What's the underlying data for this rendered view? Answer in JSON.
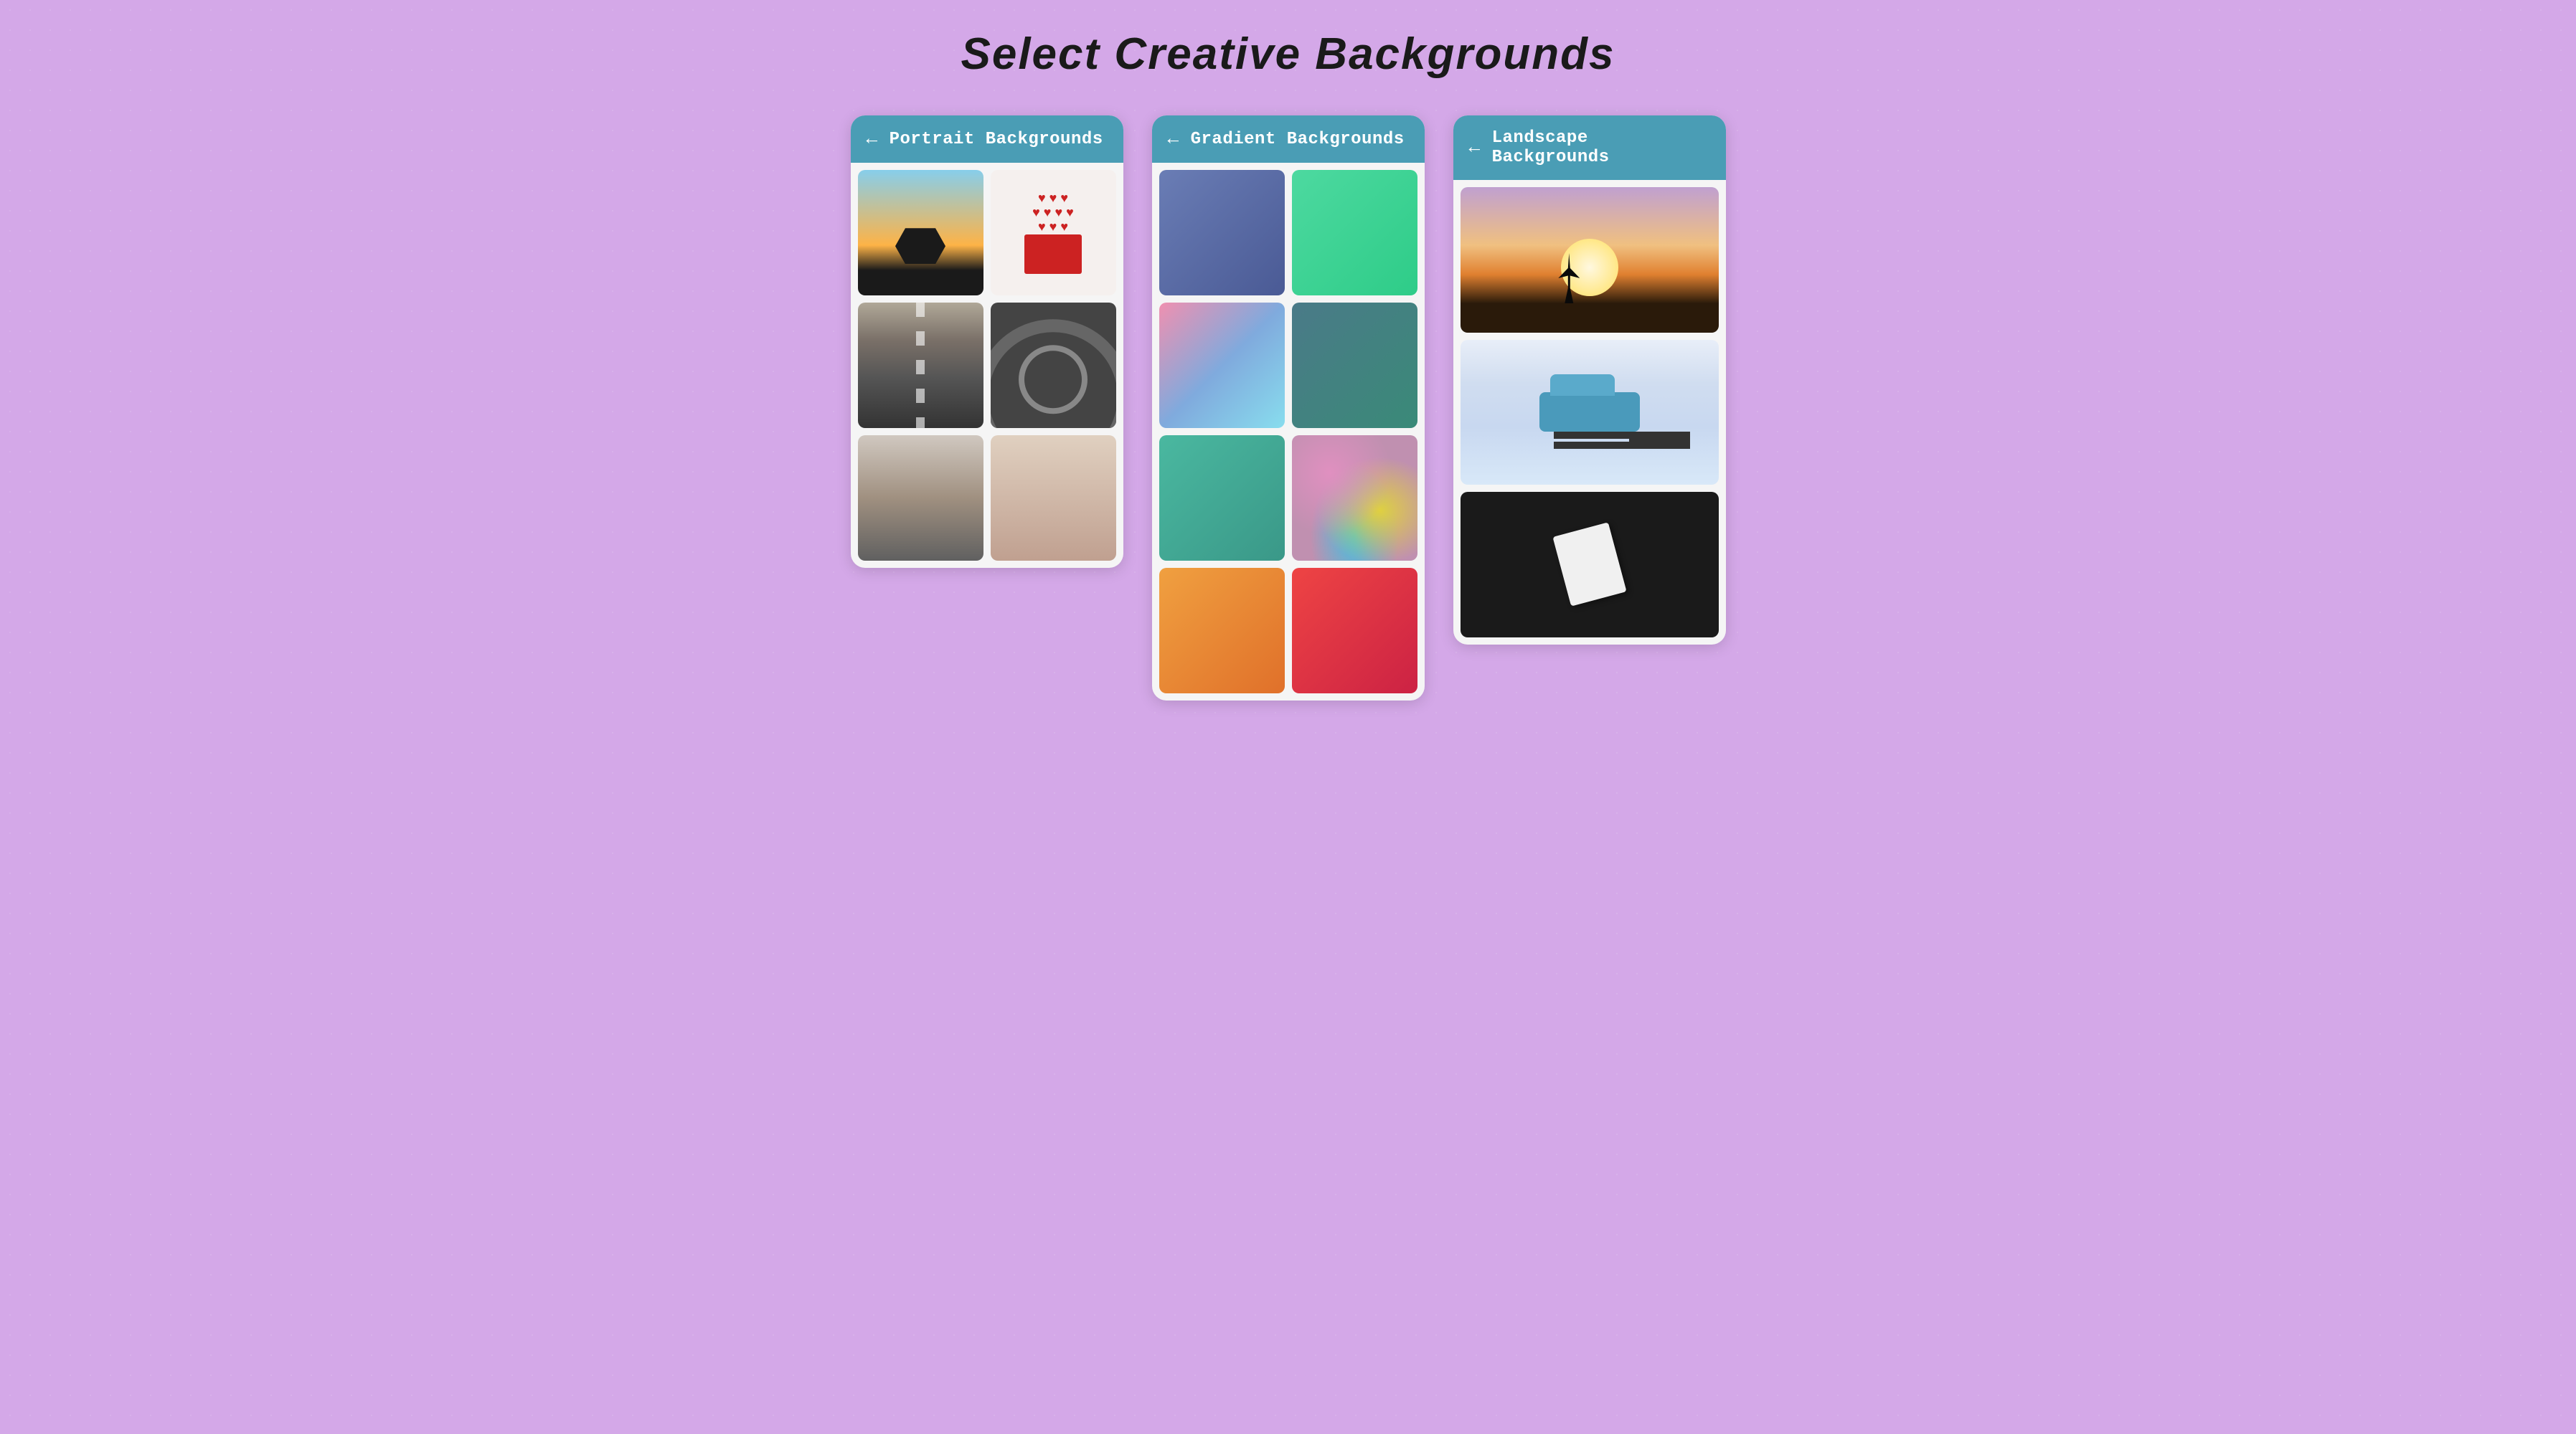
{
  "page": {
    "title": "Select Creative  Backgrounds",
    "background_color": "#d4a8e8"
  },
  "panels": [
    {
      "id": "portrait",
      "header_label": "Portrait Backgrounds",
      "back_label": "←"
    },
    {
      "id": "gradient",
      "header_label": "Gradient Backgrounds",
      "back_label": "←"
    },
    {
      "id": "landscape",
      "header_label": "Landscape Backgrounds",
      "back_label": "←"
    }
  ],
  "gradient_items": [
    {
      "id": "g1",
      "label": "Blue gradient"
    },
    {
      "id": "g2",
      "label": "Green gradient"
    },
    {
      "id": "g3",
      "label": "Pink blue gradient"
    },
    {
      "id": "g4",
      "label": "Teal gradient"
    },
    {
      "id": "g5",
      "label": "Teal dark gradient"
    },
    {
      "id": "g6",
      "label": "Colorful gradient"
    },
    {
      "id": "g7",
      "label": "Orange gradient"
    },
    {
      "id": "g8",
      "label": "Red gradient"
    }
  ]
}
